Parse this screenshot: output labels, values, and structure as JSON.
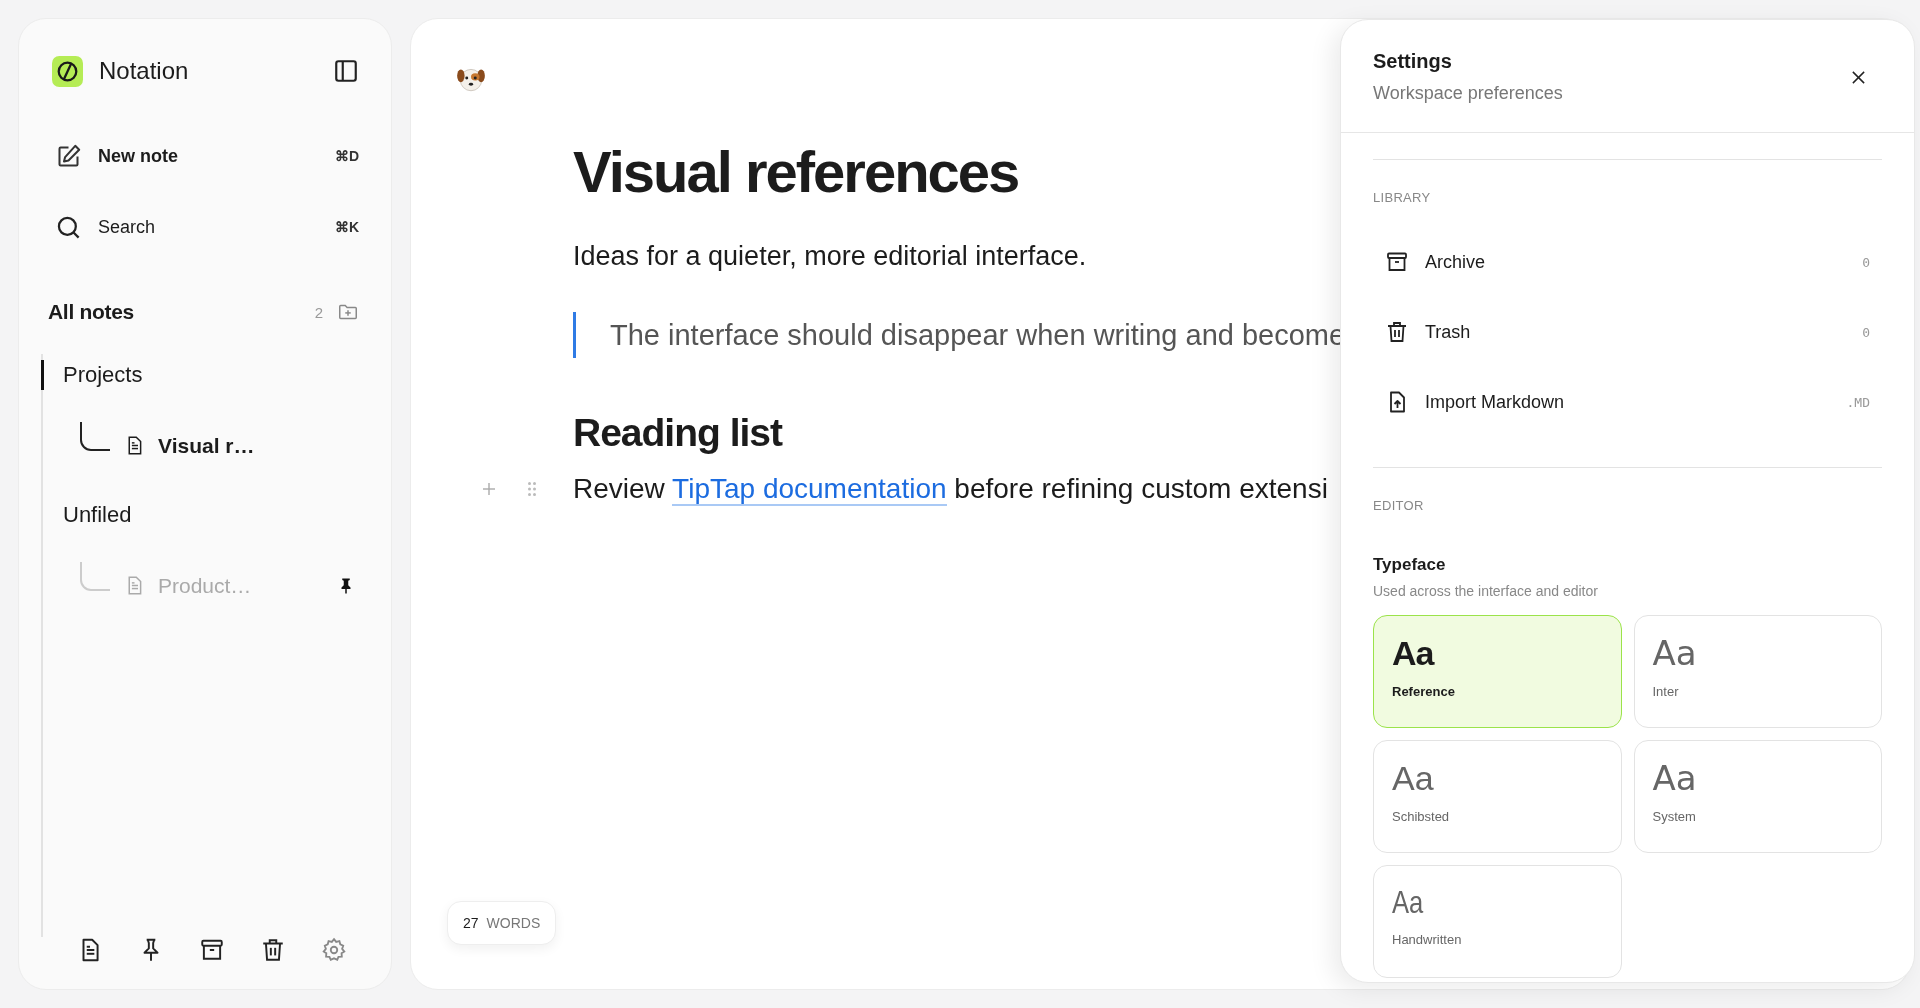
{
  "sidebar": {
    "app_name": "Notation",
    "actions": [
      {
        "label": "New note",
        "shortcut": "⌘D",
        "emphasis": true
      },
      {
        "label": "Search",
        "shortcut": "⌘K",
        "emphasis": false
      }
    ],
    "section": {
      "title": "All notes",
      "count": "2"
    },
    "groups": [
      {
        "name": "Projects",
        "active": true,
        "children": [
          {
            "title": "Visual r…",
            "selected": true,
            "pinned": false
          }
        ]
      },
      {
        "name": "Unfiled",
        "active": false,
        "children": [
          {
            "title": "Product…",
            "selected": false,
            "pinned": true
          }
        ]
      }
    ]
  },
  "editor": {
    "title": "Visual references",
    "lead": "Ideas for a quieter, more editorial interface.",
    "quote": "The interface should disappear when writing and become",
    "heading": "Reading list",
    "paragraph": {
      "before": "Review ",
      "link": "TipTap documentation",
      "after": " before refining custom extensi"
    },
    "word_count": {
      "number": "27",
      "unit": "WORDS"
    }
  },
  "settings": {
    "title": "Settings",
    "subtitle": "Workspace preferences",
    "library": {
      "label": "LIBRARY",
      "items": [
        {
          "kind": "archive",
          "label": "Archive",
          "value": "0"
        },
        {
          "kind": "trash",
          "label": "Trash",
          "value": "0"
        },
        {
          "kind": "import",
          "label": "Import Markdown",
          "value": ".MD"
        }
      ]
    },
    "editor_section": {
      "label": "EDITOR",
      "typeface": {
        "title": "Typeface",
        "hint": "Used across the interface and editor",
        "options": [
          {
            "sample": "Aa",
            "label": "Reference",
            "selected": true
          },
          {
            "sample": "Aa",
            "label": "Inter",
            "selected": false
          },
          {
            "sample": "Aa",
            "label": "Schibsted",
            "selected": false
          },
          {
            "sample": "Aa",
            "label": "System",
            "selected": false
          },
          {
            "sample": "Aa",
            "label": "Handwritten",
            "selected": false
          }
        ]
      }
    }
  }
}
